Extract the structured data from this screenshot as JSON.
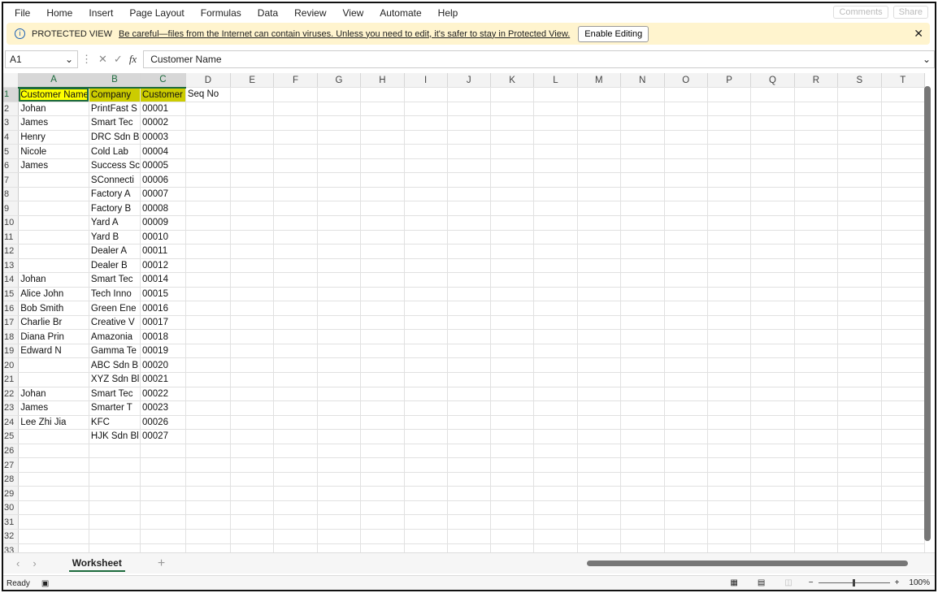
{
  "menu": [
    "File",
    "Home",
    "Insert",
    "Page Layout",
    "Formulas",
    "Data",
    "Review",
    "View",
    "Automate",
    "Help"
  ],
  "comments_label": "Comments",
  "share_label": "Share",
  "banner": {
    "title": "PROTECTED VIEW",
    "message": "Be careful—files from the Internet can contain viruses. Unless you need to edit, it's safer to stay in Protected View.",
    "button": "Enable Editing"
  },
  "formula": {
    "cell": "A1",
    "value": "Customer Name"
  },
  "columns": [
    "A",
    "B",
    "C",
    "D",
    "E",
    "F",
    "G",
    "H",
    "I",
    "J",
    "K",
    "L",
    "M",
    "N",
    "O",
    "P",
    "Q",
    "R",
    "S",
    "T"
  ],
  "rows": [
    [
      "Customer Name",
      "Company",
      "Customer",
      "Seq No"
    ],
    [
      "Johan",
      "PrintFast S",
      "00001"
    ],
    [
      "James",
      "Smart Tec",
      "00002"
    ],
    [
      "Henry",
      "DRC Sdn B",
      "00003"
    ],
    [
      "Nicole",
      "Cold Lab",
      "00004"
    ],
    [
      "James",
      "Success Sc",
      "00005"
    ],
    [
      "",
      "SConnecti",
      "00006"
    ],
    [
      "",
      "Factory A",
      "00007"
    ],
    [
      "",
      "Factory B",
      "00008"
    ],
    [
      "",
      "Yard A",
      "00009"
    ],
    [
      "",
      "Yard B",
      "00010"
    ],
    [
      "",
      "Dealer A",
      "00011"
    ],
    [
      "",
      "Dealer B",
      "00012"
    ],
    [
      "Johan",
      "Smart Tec",
      "00014"
    ],
    [
      "Alice John",
      "Tech Inno",
      "00015"
    ],
    [
      "Bob Smith",
      "Green Ene",
      "00016"
    ],
    [
      "Charlie Br",
      "Creative V",
      "00017"
    ],
    [
      "Diana Prin",
      "Amazonia",
      "00018"
    ],
    [
      "Edward N",
      "Gamma Te",
      "00019"
    ],
    [
      "",
      "ABC Sdn B",
      "00020"
    ],
    [
      "",
      "XYZ Sdn Bl",
      "00021"
    ],
    [
      "Johan",
      "Smart Tec",
      "00022"
    ],
    [
      "James",
      "Smarter T",
      "00023"
    ],
    [
      "Lee Zhi Jia",
      "KFC",
      "00026"
    ],
    [
      "",
      "HJK Sdn Bl",
      "00027"
    ]
  ],
  "total_rows": 33,
  "sheet_tab": "Worksheet",
  "status": "Ready",
  "zoom": {
    "label": "100%",
    "percent": 100
  },
  "colors": {
    "header_yellow": "#ffff00",
    "header_olive": "#cccc00",
    "accent": "#1d6b3d",
    "banner": "#FFF4CE"
  }
}
